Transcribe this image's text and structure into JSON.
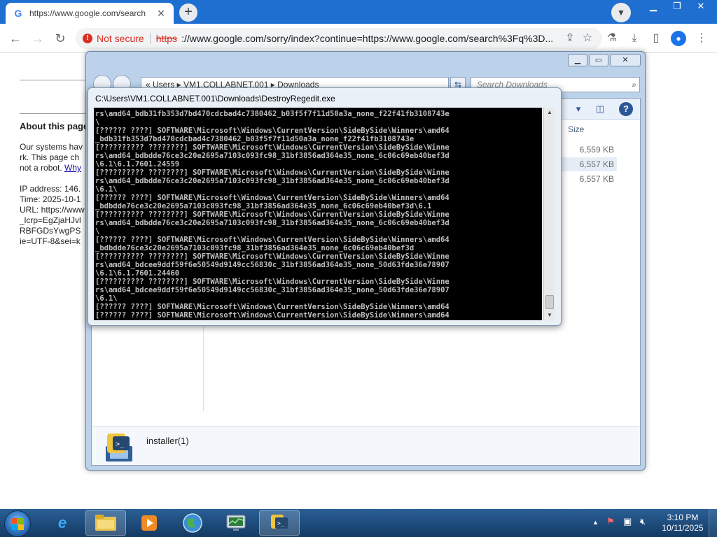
{
  "browser": {
    "tab_title": "https://www.google.com/search",
    "tab_favicon": "G",
    "not_secure_label": "Not secure",
    "url_scheme": "https",
    "url_rest": "://www.google.com/sorry/index?continue=https://www.google.com/search%3Fq%3D..."
  },
  "sorry_page": {
    "heading": "About this page",
    "p1_line1": "Our systems hav",
    "p1_line2": "rk. This page ch",
    "p1_line3a": "not a robot. ",
    "p1_link": "Why",
    "ip": "IP address: 146.",
    "time": "Time: 2025-10-1",
    "url": "URL: https://www",
    "url2": "_lcrp=EgZjaHJvl",
    "url3": "RBFGDsYwgPS",
    "url4": "ie=UTF-8&sei=k"
  },
  "explorer": {
    "address": "«   Users  ▸  VM1.COLLABNET.001  ▸  Downloads",
    "search_placeholder": "Search Downloads",
    "size_header": "Size",
    "sizes": [
      "6,559 KB",
      "6,557 KB",
      "6,557 KB"
    ],
    "selected_file": "installer(1)"
  },
  "console": {
    "title": "C:\\Users\\VM1.COLLABNET.001\\Downloads\\DestroyRegedit.exe",
    "lines": [
      "rs\\amd64_bdb31fb353d7bd470cdcbad4c7380462_b03f5f7f11d50a3a_none_f22f41fb3108743e",
      "\\",
      "[?????? ????] SOFTWARE\\Microsoft\\Windows\\CurrentVersion\\SideBySide\\Winners\\amd64",
      "_bdb31fb353d7bd470cdcbad4c7380462_b03f5f7f11d50a3a_none_f22f41fb3108743e",
      "[?????????? ????????] SOFTWARE\\Microsoft\\Windows\\CurrentVersion\\SideBySide\\Winne",
      "rs\\amd64_bdbdde76ce3c20e2695a7103c093fc98_31bf3856ad364e35_none_6c06c69eb40bef3d",
      "\\6.1\\6.1.7601.24559",
      "[?????????? ????????] SOFTWARE\\Microsoft\\Windows\\CurrentVersion\\SideBySide\\Winne",
      "rs\\amd64_bdbdde76ce3c20e2695a7103c093fc98_31bf3856ad364e35_none_6c06c69eb40bef3d",
      "\\6.1\\",
      "[?????? ????] SOFTWARE\\Microsoft\\Windows\\CurrentVersion\\SideBySide\\Winners\\amd64",
      "_bdbdde76ce3c20e2695a7103c093fc98_31bf3856ad364e35_none_6c06c69eb40bef3d\\6.1",
      "[?????????? ????????] SOFTWARE\\Microsoft\\Windows\\CurrentVersion\\SideBySide\\Winne",
      "rs\\amd64_bdbdde76ce3c20e2695a7103c093fc98_31bf3856ad364e35_none_6c06c69eb40bef3d",
      "\\",
      "[?????? ????] SOFTWARE\\Microsoft\\Windows\\CurrentVersion\\SideBySide\\Winners\\amd64",
      "_bdbdde76ce3c20e2695a7103c093fc98_31bf3856ad364e35_none_6c06c69eb40bef3d",
      "[?????????? ????????] SOFTWARE\\Microsoft\\Windows\\CurrentVersion\\SideBySide\\Winne",
      "rs\\amd64_bdcee9ddf59f6e50549d9149cc56830c_31bf3856ad364e35_none_50d63fde36e78907",
      "\\6.1\\6.1.7601.24460",
      "[?????????? ????????] SOFTWARE\\Microsoft\\Windows\\CurrentVersion\\SideBySide\\Winne",
      "rs\\amd64_bdcee9ddf59f6e50549d9149cc56830c_31bf3856ad364e35_none_50d63fde36e78907",
      "\\6.1\\",
      "[?????? ????] SOFTWARE\\Microsoft\\Windows\\CurrentVersion\\SideBySide\\Winners\\amd64",
      "[?????? ????] SOFTWARE\\Microsoft\\Windows\\CurrentVersion\\SideBySide\\Winners\\amd64"
    ]
  },
  "taskbar": {
    "time": "3:10 PM",
    "date": "10/11/2025"
  }
}
